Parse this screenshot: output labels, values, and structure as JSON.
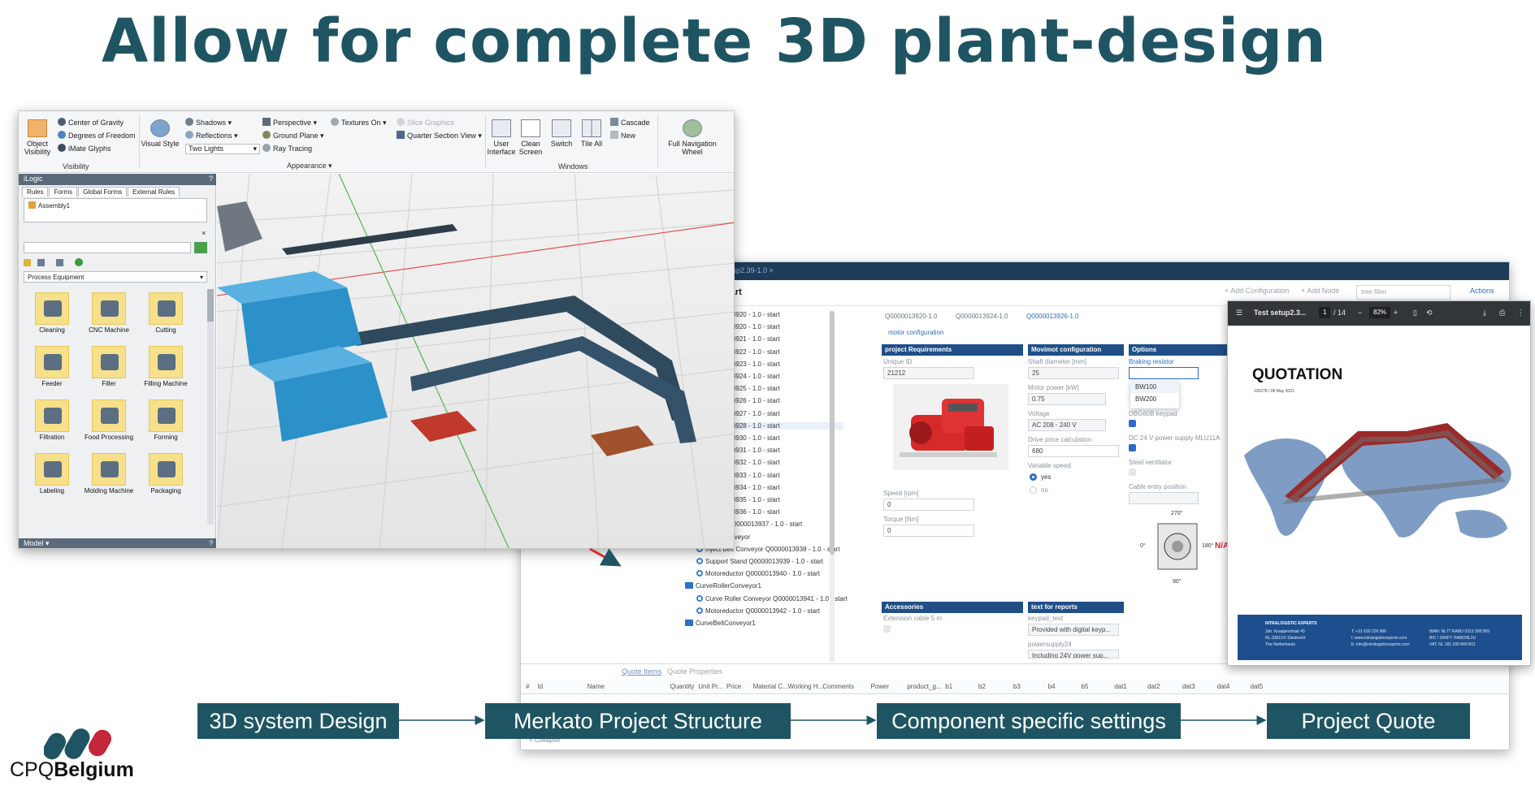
{
  "slide": {
    "title": "Allow for complete 3D plant-design",
    "flow_steps": [
      "3D system Design",
      "Merkato Project Structure",
      "Component specific settings",
      "Project Quote"
    ],
    "logo": {
      "prefix": "CPQ",
      "suffix": "Belgium"
    },
    "colors": {
      "title": "#1f5563",
      "flow_box": "#1f5563",
      "logo_red": "#c4263a",
      "logo_teal": "#1f5563"
    }
  },
  "design_app": {
    "ribbon": {
      "visibility": {
        "object_visibility": "Object\nVisibility",
        "items": [
          "Center of Gravity",
          "Degrees of Freedom",
          "iMate Glyphs"
        ],
        "group": "Visibility"
      },
      "appearance": {
        "visual_style": "Visual Style",
        "items": [
          "Shadows",
          "Reflections",
          "Perspective",
          "Ground Plane",
          "Ray Tracing",
          "Textures On"
        ],
        "lights_select": "Two Lights",
        "group": "Appearance"
      },
      "section": {
        "items": [
          "Slice Graphics",
          "Quarter Section View"
        ]
      },
      "windows": {
        "buttons": [
          "User\nInterface",
          "Clean\nScreen",
          "Switch",
          "Tile All"
        ],
        "items": [
          "Cascade",
          "New"
        ],
        "group": "Windows"
      },
      "navigation": {
        "label": "Full Navigation\nWheel"
      }
    },
    "logic_panel": {
      "title": "iLogic",
      "tabs": [
        "Rules",
        "Forms",
        "Global Forms",
        "External Rules"
      ],
      "tree_item": "Assembly1"
    },
    "library_panel": {
      "category": "Process Equipment",
      "tiles": [
        "Cleaning",
        "CNC Machine",
        "Cutting",
        "Feeder",
        "Filler",
        "Filling Machine",
        "Filtration",
        "Food Processing",
        "Forming",
        "Labeling",
        "Molding Machine",
        "Packaging"
      ]
    },
    "model_panel": {
      "title": "Model"
    }
  },
  "merkato": {
    "breadcrumb": "setup2.39-1.0 ×",
    "page_title": "start",
    "header_buttons": [
      "+ Add Configuration",
      "+ Add Node"
    ],
    "filter_placeholder": "tree filter",
    "actions": "Actions",
    "tree": [
      {
        "text": "Q0000013920 - 1.0 - start",
        "kind": "leaf"
      },
      {
        "text": "Q0000013920 - 1.0 - start",
        "kind": "leaf"
      },
      {
        "text": "Q0000013921 - 1.0 - start",
        "kind": "leaf"
      },
      {
        "text": "Q0000013922 - 1.0 - start",
        "kind": "leaf"
      },
      {
        "text": "Q0000013923 - 1.0 - start",
        "kind": "leaf"
      },
      {
        "text": "Q0000013924 - 1.0 - start",
        "kind": "leaf"
      },
      {
        "text": "Q0000013925 - 1.0 - start",
        "kind": "leaf"
      },
      {
        "text": "Q0000013926 - 1.0 - start",
        "kind": "leaf"
      },
      {
        "text": "Q0000013927 - 1.0 - start",
        "kind": "leaf"
      },
      {
        "text": "Q0000013928 - 1.0 - start",
        "kind": "leaf-selected"
      },
      {
        "text": "Q0000013930 - 1.0 - start",
        "kind": "leaf"
      },
      {
        "text": "Q0000013931 - 1.0 - start",
        "kind": "leaf"
      },
      {
        "text": "Q0000013932 - 1.0 - start",
        "kind": "leaf"
      },
      {
        "text": "Q0000013933 - 1.0 - start",
        "kind": "leaf"
      },
      {
        "text": "Q0000013934 - 1.0 - start",
        "kind": "leaf"
      },
      {
        "text": "Q0000013935 - 1.0 - start",
        "kind": "leaf"
      },
      {
        "text": "Q0000013936 - 1.0 - start",
        "kind": "leaf"
      },
      {
        "text": "Sensor  Q0000013937 - 1.0 - start",
        "kind": "leaf"
      },
      {
        "text": "InjectBeltConveyor",
        "kind": "folder"
      },
      {
        "text": "Inject Belt Conveyor  Q0000013938 - 1.0 - start",
        "kind": "leaf"
      },
      {
        "text": "Support Stand  Q0000013939 - 1.0 - start",
        "kind": "leaf"
      },
      {
        "text": "Motoreductor  Q0000013940 - 1.0 - start",
        "kind": "leaf"
      },
      {
        "text": "CurveRollerConveyor1",
        "kind": "folder"
      },
      {
        "text": "Curve Roller Conveyor  Q0000013941 - 1.0 - start",
        "kind": "leaf"
      },
      {
        "text": "Motoreductor  Q0000013942 - 1.0 - start",
        "kind": "leaf"
      },
      {
        "text": "CurveBeltConveyor1",
        "kind": "folder"
      }
    ],
    "doc_tabs": [
      "Q0000013920-1.0",
      "Q0000013924-1.0",
      "Q0000013926-1.0"
    ],
    "subtab": "motor configuration",
    "sections": {
      "project_requirements": {
        "title": "project Requirements",
        "unique_id_label": "Unique ID",
        "unique_id_value": "21212",
        "speed_label": "Speed [rpm]",
        "speed_value": "0",
        "torque_label": "Torque [Nm]",
        "torque_value": "0"
      },
      "movimot": {
        "title": "Movimot configuration",
        "shaft_label": "Shaft diameter [mm]",
        "shaft_value": "25",
        "power_label": "Motor power [kW]",
        "power_value": "0.75",
        "voltage_label": "Voltage",
        "voltage_value": "AC  208 - 240 V",
        "drive_label": "Drive price calculation",
        "drive_value": "680",
        "variable_label": "Variable speed",
        "variable_yes": "yes",
        "variable_no": "no"
      },
      "options": {
        "title": "Options",
        "braking_label": "Braking resistor",
        "braking_options": [
          "BW100",
          "BW200"
        ],
        "keypad_label": "DBG60B keypad",
        "power_supply_label": "DC 24 V power supply MLU11A",
        "steel_label": "Steel ventilator",
        "cable_label": "Cable entry position",
        "angles": [
          "270°",
          "0°",
          "180°",
          "90°"
        ],
        "na": "N/A"
      },
      "accessories": {
        "title": "Accessories",
        "extension_label": "Extension cable 5 m"
      },
      "text_reports": {
        "title": "text for reports",
        "keypad_text_label": "keypad_text",
        "keypad_text_value": "Provided with digital keyp...",
        "power_label": "powersupply24",
        "power_value": "Including 24V power sup..."
      }
    },
    "quote_tabs": [
      "Quote Items",
      "Quote Properties"
    ],
    "quote_columns": [
      "#",
      "Id",
      "Name",
      "Quantity",
      "Unit Pr...",
      "Price",
      "Material C...",
      "Working H...",
      "Comments",
      "Power",
      "product_g...",
      "b1",
      "b2",
      "b3",
      "b4",
      "b5",
      "dat1",
      "dat2",
      "dat3",
      "dat4",
      "dat5"
    ],
    "collapse": "< Collapse"
  },
  "quote_pdf": {
    "filename": "Test setup2.3...",
    "page": "1",
    "pages": "/ 14",
    "zoom": "82%",
    "title": "QUOTATION",
    "reference": "100278 / 05 May 2021",
    "footer": {
      "company": "INTRALOGISTIC EXPERTS",
      "address": [
        "Joh. Kraaijenstraat 43",
        "NL-3361XX Sliedrecht",
        "The Netherlands"
      ],
      "contact": [
        "T: +31 630 226 966",
        "I: www.intralogisticexperts.com",
        "E: info@intralogisticexperts.com"
      ],
      "bank": [
        "IBAN: NL77 RABO 0313 268 069",
        "BIC / SWIFT: RABONL2U",
        "VAT: NL 181 200 849 B01"
      ]
    }
  }
}
